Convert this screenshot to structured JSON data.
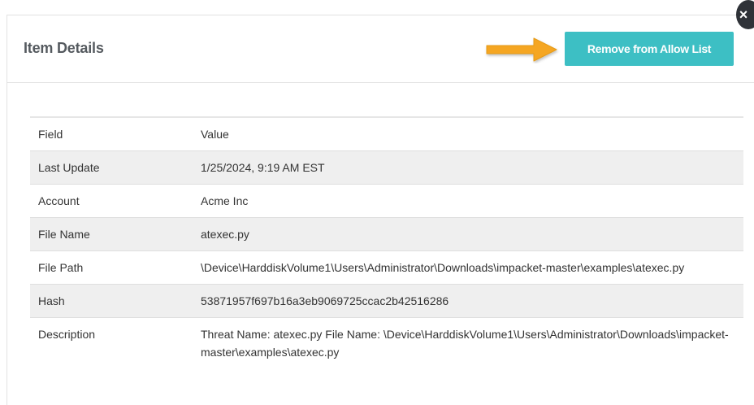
{
  "modal": {
    "title": "Item Details",
    "remove_button_label": "Remove from Allow List",
    "close_icon": "×"
  },
  "colors": {
    "accent": "#3dbfc4",
    "arrow": "#f5a623",
    "row_shade": "#efefef"
  },
  "table": {
    "headers": {
      "field": "Field",
      "value": "Value"
    },
    "rows": [
      {
        "field": "Last Update",
        "value": "1/25/2024, 9:19 AM EST"
      },
      {
        "field": "Account",
        "value": "Acme Inc"
      },
      {
        "field": "File Name",
        "value": "atexec.py"
      },
      {
        "field": "File Path",
        "value": "\\Device\\HarddiskVolume1\\Users\\Administrator\\Downloads\\impacket-master\\examples\\atexec.py"
      },
      {
        "field": "Hash",
        "value": "53871957f697b16a3eb9069725ccac2b42516286"
      },
      {
        "field": "Description",
        "value": "Threat Name: atexec.py File Name: \\Device\\HarddiskVolume1\\Users\\Administrator\\Downloads\\impacket-master\\examples\\atexec.py"
      }
    ]
  }
}
